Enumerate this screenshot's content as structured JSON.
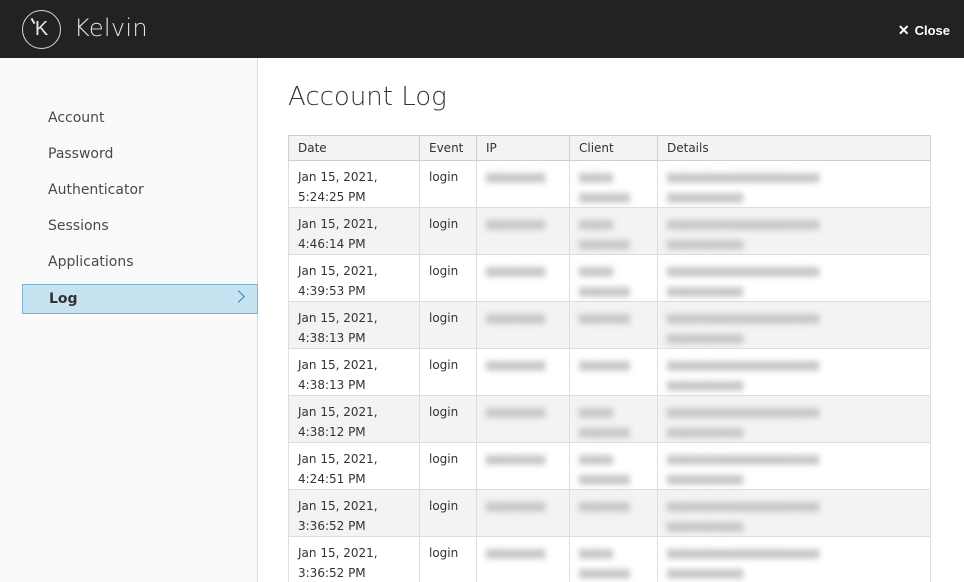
{
  "header": {
    "brand": "Kelvin",
    "logo_letter": "K",
    "close_label": "Close"
  },
  "sidebar": {
    "items": [
      {
        "label": "Account"
      },
      {
        "label": "Password"
      },
      {
        "label": "Authenticator"
      },
      {
        "label": "Sessions"
      },
      {
        "label": "Applications"
      },
      {
        "label": "Log"
      }
    ],
    "active": "Log"
  },
  "main": {
    "title": "Account Log",
    "columns": [
      "Date",
      "Event",
      "IP",
      "Client",
      "Details"
    ],
    "rows": [
      {
        "date1": "Jan 15, 2021,",
        "date2": "5:24:25 PM",
        "event": "login"
      },
      {
        "date1": "Jan 15, 2021,",
        "date2": "4:46:14 PM",
        "event": "login"
      },
      {
        "date1": "Jan 15, 2021,",
        "date2": "4:39:53 PM",
        "event": "login"
      },
      {
        "date1": "Jan 15, 2021,",
        "date2": "4:38:13 PM",
        "event": "login"
      },
      {
        "date1": "Jan 15, 2021,",
        "date2": "4:38:13 PM",
        "event": "login"
      },
      {
        "date1": "Jan 15, 2021,",
        "date2": "4:38:12 PM",
        "event": "login"
      },
      {
        "date1": "Jan 15, 2021,",
        "date2": "4:24:51 PM",
        "event": "login"
      },
      {
        "date1": "Jan 15, 2021,",
        "date2": "3:36:52 PM",
        "event": "login"
      },
      {
        "date1": "Jan 15, 2021,",
        "date2": "3:36:52 PM",
        "event": "login"
      }
    ]
  },
  "icons": {
    "close": "close-icon",
    "chevron": "chevron-right-icon",
    "logo": "kelvin-logo"
  },
  "colors": {
    "header_bg": "#222222",
    "active_bg": "#c6e3f2",
    "active_border": "#7fb3d3"
  }
}
